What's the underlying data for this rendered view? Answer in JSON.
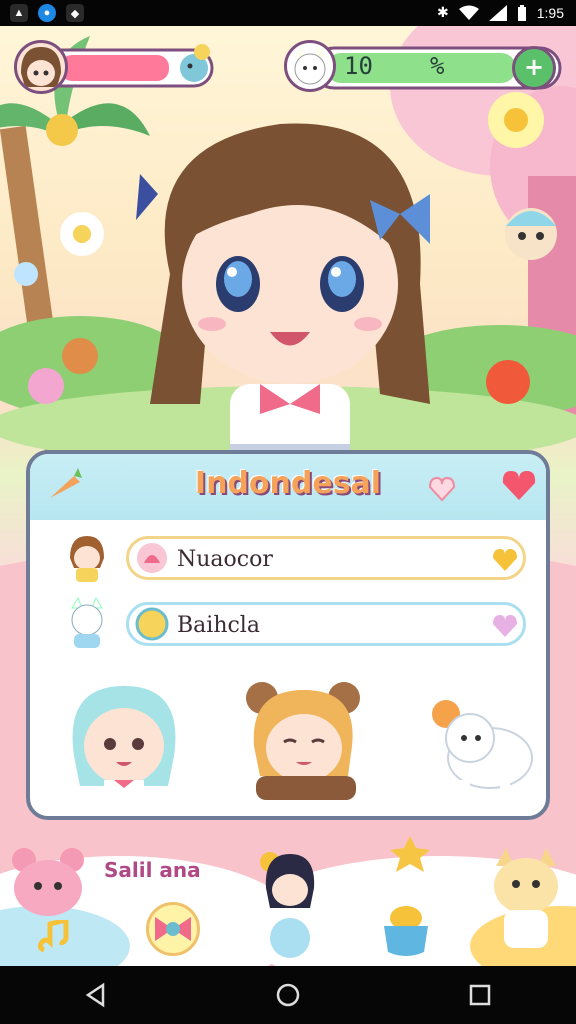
{
  "status_bar": {
    "time": "1:95"
  },
  "hud": {
    "player_health_percent": 78,
    "currency_value": "10",
    "secondary_value": "%",
    "add_label": "+"
  },
  "panel": {
    "title": "Indondesal",
    "rows": [
      {
        "label": "Nuaocor"
      },
      {
        "label": "Baihcla"
      }
    ]
  },
  "bottom": {
    "label": "Salil ana"
  },
  "colors": {
    "accent": "#f5a25a",
    "hud_green": "#6bd46b",
    "hud_red": "#ff7a9a",
    "panel_border": "#6f7c97"
  }
}
